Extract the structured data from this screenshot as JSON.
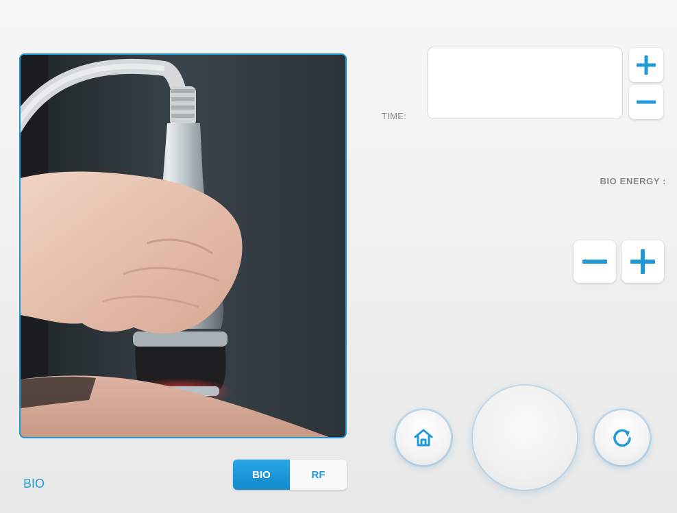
{
  "mode": {
    "label": "BIO",
    "toggle_options": [
      "BIO",
      "RF"
    ],
    "selected": "BIO"
  },
  "time": {
    "label": "TIME:",
    "value": ""
  },
  "bio_energy": {
    "label": "BIO ENERGY :",
    "value": ""
  },
  "icons": {
    "home": "home-icon",
    "reset": "refresh-icon",
    "plus": "plus-icon",
    "minus": "minus-icon"
  },
  "colors": {
    "accent": "#1e9ad8",
    "label_gray": "#8a8a8a",
    "background": "#f1f1f1"
  }
}
